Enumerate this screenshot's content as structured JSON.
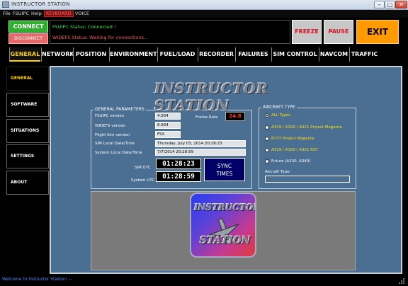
{
  "window": {
    "title": "INSTRUCTOR STATION"
  },
  "menubar": {
    "items": [
      "File",
      "FSUIPC",
      "Help",
      "KEYBOARD",
      "VOICE"
    ]
  },
  "controls": {
    "connect": "CONNECT",
    "disconnect": "DISCONNECT",
    "freeze": "FREEZE",
    "pause": "PAUSE",
    "exit": "EXIT"
  },
  "status": {
    "line1": "FSUIPC Status: Connected !",
    "line2": "WIDEFS Status: Waiting for connections..."
  },
  "tabs": [
    "GENERAL",
    "NETWORK",
    "POSITION",
    "ENVIRONMENT",
    "FUEL/LOAD",
    "RECORDER",
    "FAILURES",
    "SIM CONTROL",
    "NAVCOM",
    "TRAFFIC"
  ],
  "sidebar": {
    "items": [
      "GENERAL",
      "SOFTWARE",
      "SITUATIONS",
      "SETTINGS",
      "ABOUT"
    ]
  },
  "main": {
    "logo_title": "INSTRUCTOR STATION",
    "general": {
      "title": "GENERAL PARAMETERS",
      "fsuipc_label": "FSUIPC version",
      "fsuipc_value": "4.934",
      "widefs_label": "WIDEFS version",
      "widefs_value": "6.934",
      "flight_sim_label": "Flight Sim version",
      "flight_sim_value": "FSX",
      "sim_local_label": "SIM Local Date/Time",
      "sim_local_value": "Thursday, July 03, 2014 20:28:23",
      "system_local_label": "System Local Date/Time",
      "system_local_value": "7/7/2014 20:28:59",
      "frame_rate_label": "Frame Rate",
      "frame_rate_value": "24.8",
      "sim_utc_label": "SIM UTC",
      "sim_utc_value": "01:28:23",
      "system_utc_label": "System UTC",
      "system_utc_value": "01:28:59",
      "sync_label": "SYNC TIMES"
    },
    "aircraft": {
      "title": "AIRCRAFT TYPE",
      "options": [
        "ALL Types",
        "A319 / A320 / A321 Project Magenta",
        "B737 Project Magenta",
        "A319 / A320 / A321 RST",
        "Future (A330, A340)"
      ],
      "selected_index": 0,
      "type_label": "Aircraft Type:"
    },
    "big_logo": {
      "word1": "INSTRUCTOR",
      "word2": "STATION"
    }
  },
  "statusbar": {
    "text": "Welcome to Instructor Station! --"
  },
  "colors": {
    "panel": "#4a6f93",
    "accent_yellow": "#ffd200",
    "exit_orange": "#ff9a00",
    "connect_green": "#2fae2f",
    "status_green": "#45e045"
  }
}
